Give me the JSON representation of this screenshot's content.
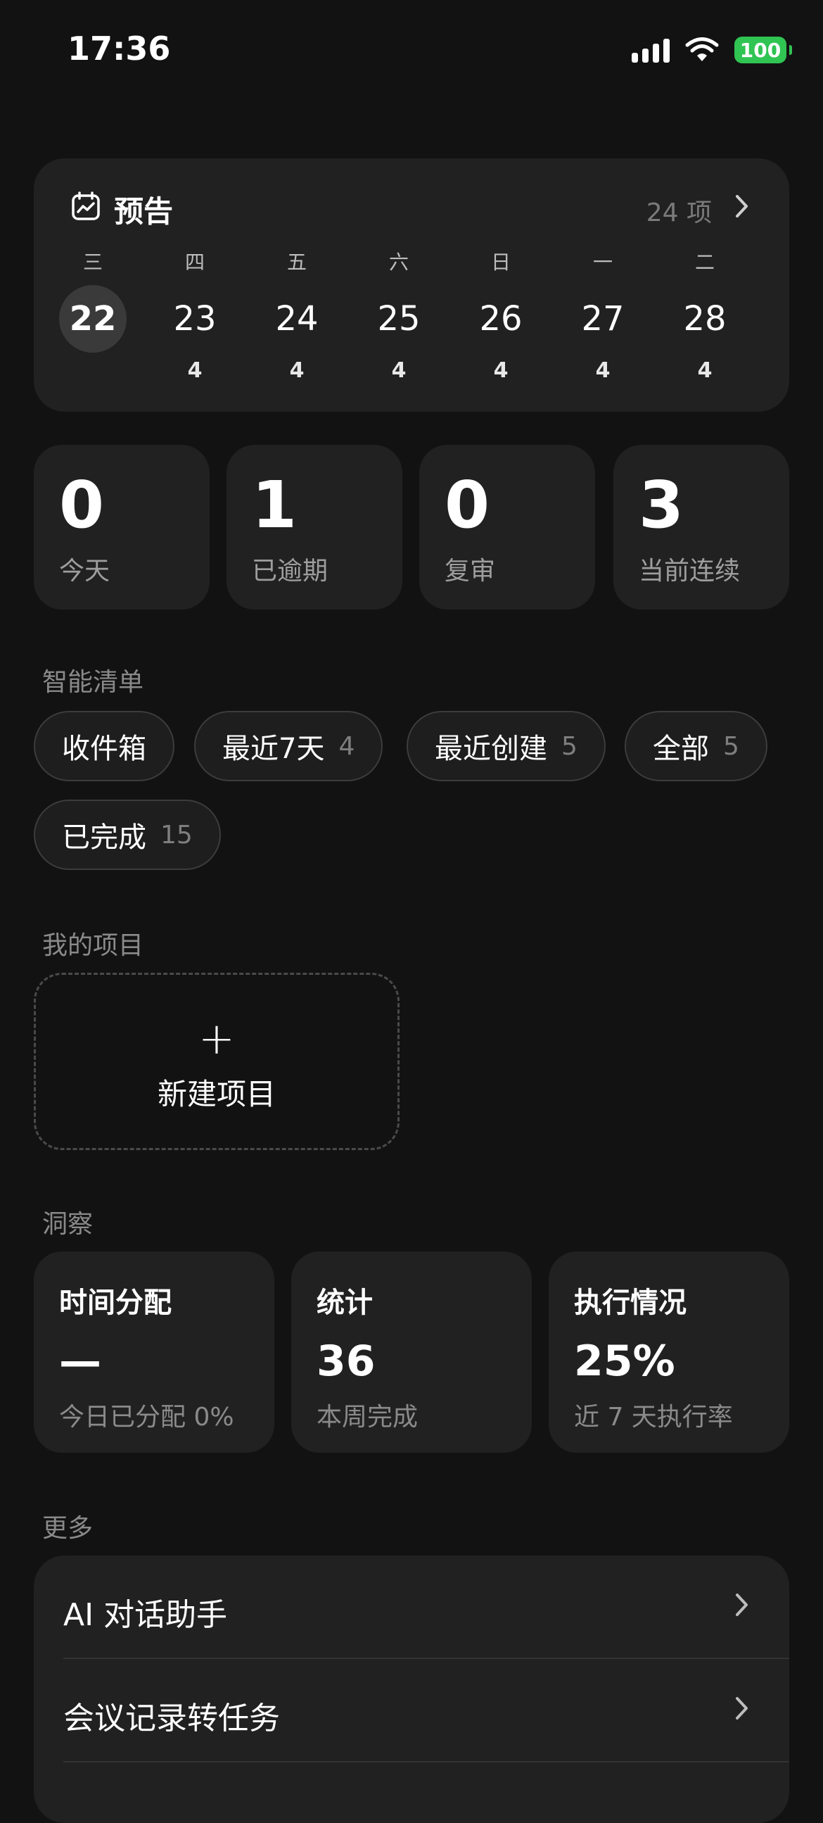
{
  "status_bar": {
    "time": "17:36",
    "battery": "100",
    "battery_color": "#30c453"
  },
  "forecast": {
    "icon": "calendar-chart-icon",
    "title": "预告",
    "count": "24 项",
    "days": [
      {
        "weekday": "三",
        "date": "22",
        "count": "",
        "today": true
      },
      {
        "weekday": "四",
        "date": "23",
        "count": "4"
      },
      {
        "weekday": "五",
        "date": "24",
        "count": "4"
      },
      {
        "weekday": "六",
        "date": "25",
        "count": "4"
      },
      {
        "weekday": "日",
        "date": "26",
        "count": "4"
      },
      {
        "weekday": "一",
        "date": "27",
        "count": "4"
      },
      {
        "weekday": "二",
        "date": "28",
        "count": "4"
      }
    ]
  },
  "stats": [
    {
      "value": "0",
      "label": "今天"
    },
    {
      "value": "1",
      "label": "已逾期"
    },
    {
      "value": "0",
      "label": "复审"
    },
    {
      "value": "3",
      "label": "当前连续"
    }
  ],
  "smart_lists": {
    "title": "智能清单",
    "items": [
      {
        "label": "收件箱",
        "count": ""
      },
      {
        "label": "最近7天",
        "count": "4"
      },
      {
        "label": "最近创建",
        "count": "5"
      },
      {
        "label": "全部",
        "count": "5"
      },
      {
        "label": "已完成",
        "count": "15"
      }
    ]
  },
  "projects": {
    "title": "我的项目",
    "new_label": "新建项目",
    "new_icon": "plus-icon"
  },
  "insights": {
    "title": "洞察",
    "cards": [
      {
        "title": "时间分配",
        "value": "—",
        "sub": "今日已分配 0%"
      },
      {
        "title": "统计",
        "value": "36",
        "sub": "本周完成"
      },
      {
        "title": "执行情况",
        "value": "25%",
        "sub": "近 7 天执行率"
      }
    ]
  },
  "more": {
    "title": "更多",
    "items": [
      {
        "label": "AI 对话助手"
      },
      {
        "label": "会议记录转任务"
      }
    ]
  }
}
